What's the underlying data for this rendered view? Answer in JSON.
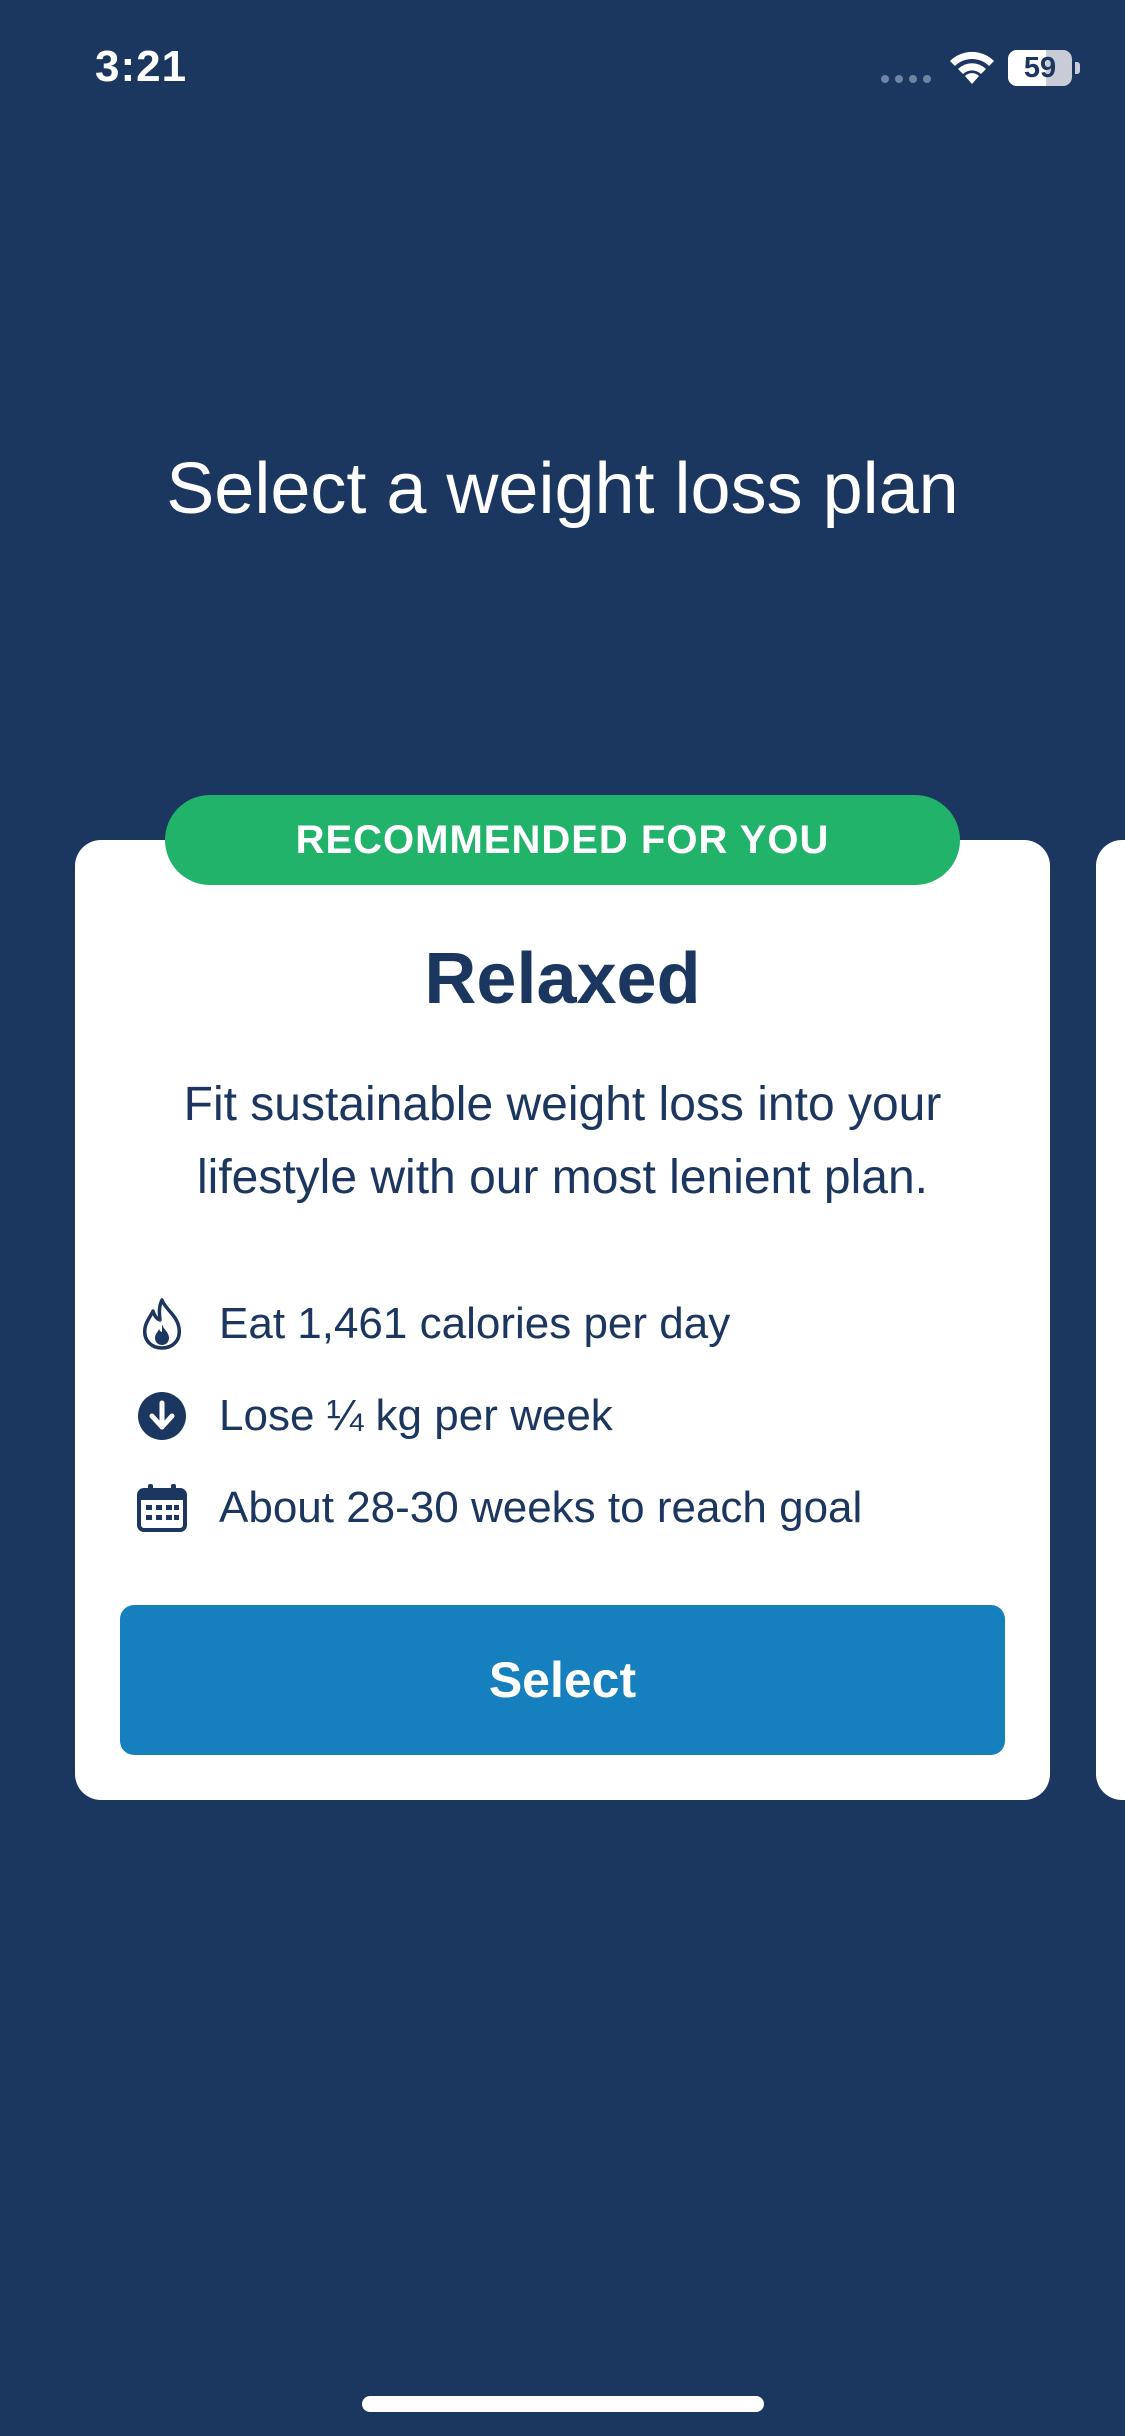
{
  "status_bar": {
    "time": "3:21",
    "battery_level": "59",
    "battery_fraction": 0.59,
    "icons": [
      "cellular-signal-icon",
      "wifi-icon",
      "battery-icon"
    ]
  },
  "page": {
    "title": "Select a weight loss plan"
  },
  "plan_card": {
    "badge": "RECOMMENDED FOR YOU",
    "name": "Relaxed",
    "description": "Fit sustainable weight loss into your lifestyle with our most lenient plan.",
    "features": [
      {
        "icon": "flame-icon",
        "text": "Eat 1,461 calories per day"
      },
      {
        "icon": "arrow-down-circle-icon",
        "text": "Lose ¼ kg per week"
      },
      {
        "icon": "calendar-icon",
        "text": "About 28-30 weeks to reach goal"
      }
    ],
    "select_label": "Select"
  },
  "colors": {
    "background": "#1b3760",
    "card": "#ffffff",
    "badge": "#22b36a",
    "button": "#1580bd",
    "text_dark": "#1b3760"
  }
}
